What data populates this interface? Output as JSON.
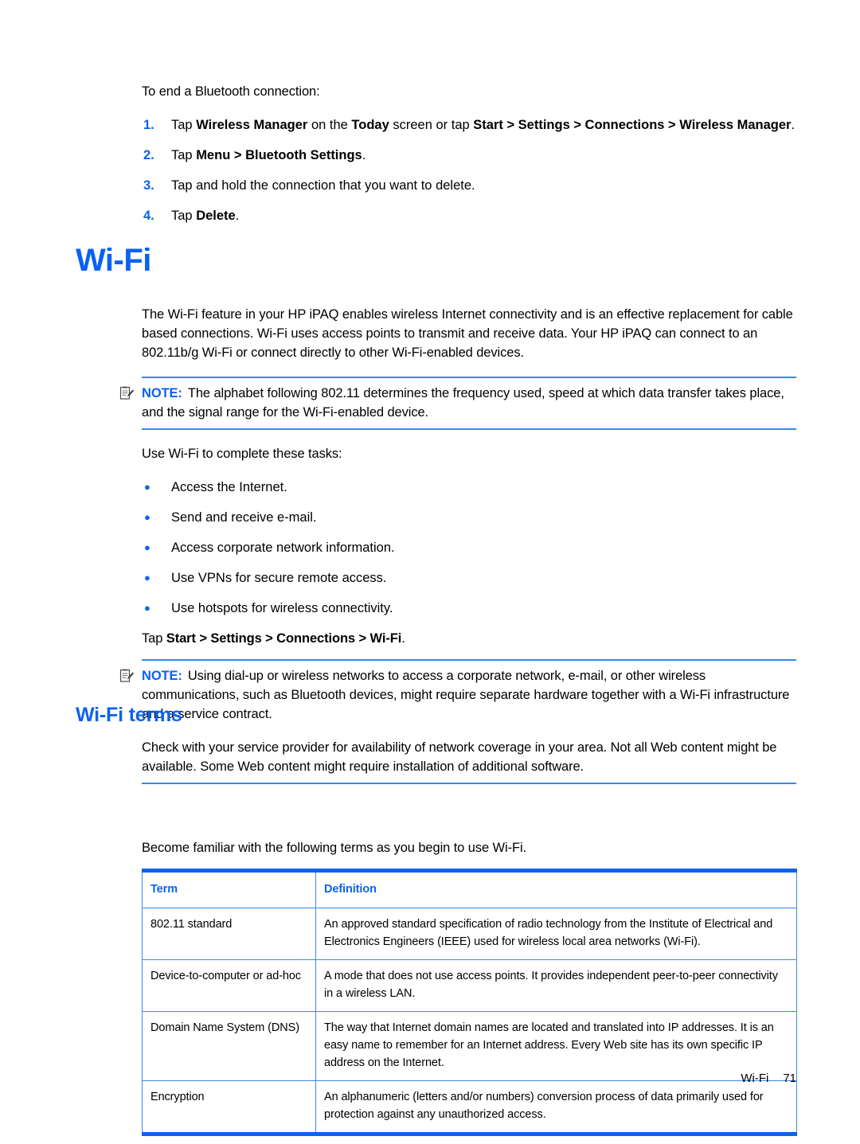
{
  "colors": {
    "accent": "#0a62f0",
    "rule": "#3a86f5",
    "text": "#000000"
  },
  "intro": {
    "lead": "To end a Bluetooth connection:"
  },
  "steps": [
    {
      "number": "1.",
      "parts": [
        {
          "text": "Tap ",
          "bold": false
        },
        {
          "text": "Wireless Manager",
          "bold": true
        },
        {
          "text": " on the ",
          "bold": false
        },
        {
          "text": "Today",
          "bold": true
        },
        {
          "text": " screen or tap ",
          "bold": false
        },
        {
          "text": "Start > Settings > Connections > Wireless Manager",
          "bold": true
        },
        {
          "text": ".",
          "bold": false
        }
      ]
    },
    {
      "number": "2.",
      "parts": [
        {
          "text": "Tap ",
          "bold": false
        },
        {
          "text": "Menu > Bluetooth Settings",
          "bold": true
        },
        {
          "text": ".",
          "bold": false
        }
      ]
    },
    {
      "number": "3.",
      "parts": [
        {
          "text": "Tap and hold the connection that you want to delete.",
          "bold": false
        }
      ]
    },
    {
      "number": "4.",
      "parts": [
        {
          "text": "Tap ",
          "bold": false
        },
        {
          "text": "Delete",
          "bold": true
        },
        {
          "text": ".",
          "bold": false
        }
      ]
    }
  ],
  "wifi_section": {
    "heading": "Wi-Fi",
    "paragraph": "The Wi-Fi feature in your HP iPAQ enables wireless Internet connectivity and is an effective replacement for cable based connections. Wi-Fi uses access points to transmit and receive data. Your HP iPAQ can connect to an 802.11b/g Wi-Fi or connect directly to other Wi-Fi-enabled devices.",
    "note1": {
      "label": "NOTE:",
      "icon": "note-clipboard-pencil-icon",
      "text": "The alphabet following 802.11 determines the frequency used, speed at which data transfer takes place, and the signal range for the Wi-Fi-enabled device."
    },
    "tasks_lead": "Use Wi-Fi to complete these tasks:",
    "tasks": [
      "Access the Internet.",
      "Send and receive e-mail.",
      "Access corporate network information.",
      "Use VPNs for secure remote access.",
      "Use hotspots for wireless connectivity."
    ],
    "tap_path": [
      {
        "text": "Tap ",
        "bold": false
      },
      {
        "text": "Start > Settings > Connections > Wi-Fi",
        "bold": true
      },
      {
        "text": ".",
        "bold": false
      }
    ],
    "note2": {
      "label": "NOTE:",
      "icon": "note-clipboard-pencil-icon",
      "text": "Using dial-up or wireless networks to access a corporate network, e-mail, or other wireless communications, such as Bluetooth devices, might require separate hardware together with a Wi-Fi infrastructure and a service contract.",
      "extra": "Check with your service provider for availability of network coverage in your area. Not all Web content might be available. Some Web content might require installation of additional software."
    }
  },
  "terms_section": {
    "heading": "Wi-Fi terms",
    "lead": "Become familiar with the following terms as you begin to use Wi-Fi.",
    "table": {
      "headers": [
        "Term",
        "Definition"
      ],
      "rows": [
        {
          "term": "802.11 standard",
          "definition": "An approved standard specification of radio technology from the Institute of Electrical and Electronics Engineers (IEEE) used for wireless local area networks (Wi-Fi)."
        },
        {
          "term": "Device-to-computer or ad-hoc",
          "definition": "A mode that does not use access points. It provides independent peer-to-peer connectivity in a wireless LAN."
        },
        {
          "term": "Domain Name System (DNS)",
          "definition": "The way that Internet domain names are located and translated into IP addresses. It is an easy name to remember for an Internet address. Every Web site has its own specific IP address on the Internet."
        },
        {
          "term": "Encryption",
          "definition": "An alphanumeric (letters and/or numbers) conversion process of data primarily used for protection against any unauthorized access."
        }
      ]
    }
  },
  "footer": {
    "label": "Wi-Fi",
    "page_number": "71"
  }
}
